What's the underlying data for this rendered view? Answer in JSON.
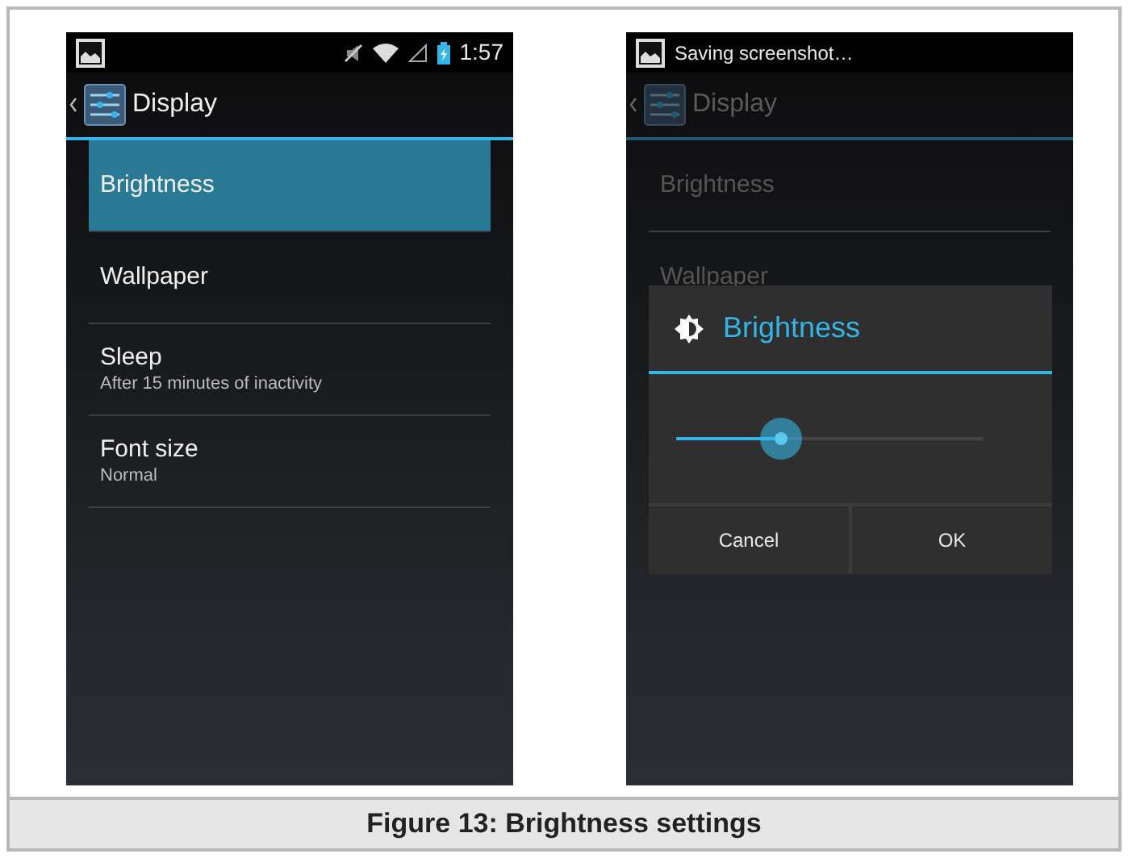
{
  "screens": [
    {
      "status_bar": {
        "time": "1:57"
      },
      "action_bar": {
        "title": "Display"
      },
      "dimmed": false,
      "items": [
        {
          "title": "Brightness",
          "selected": true
        },
        {
          "title": "Wallpaper",
          "selected": false
        },
        {
          "title": "Sleep",
          "summary": "After 15 minutes of inactivity",
          "selected": false
        },
        {
          "title": "Font size",
          "summary": "Normal",
          "selected": false
        }
      ]
    },
    {
      "status_bar": {
        "ticker": "Saving screenshot…"
      },
      "action_bar": {
        "title": "Display"
      },
      "dimmed": true,
      "items": [
        {
          "title": "Brightness",
          "selected": false
        },
        {
          "title": "Wallpaper",
          "selected": false
        }
      ],
      "dialog": {
        "title": "Brightness",
        "slider": {
          "level": 0.34
        },
        "buttons": [
          "Cancel",
          "OK"
        ]
      }
    }
  ],
  "caption": "Figure 13: Brightness settings"
}
